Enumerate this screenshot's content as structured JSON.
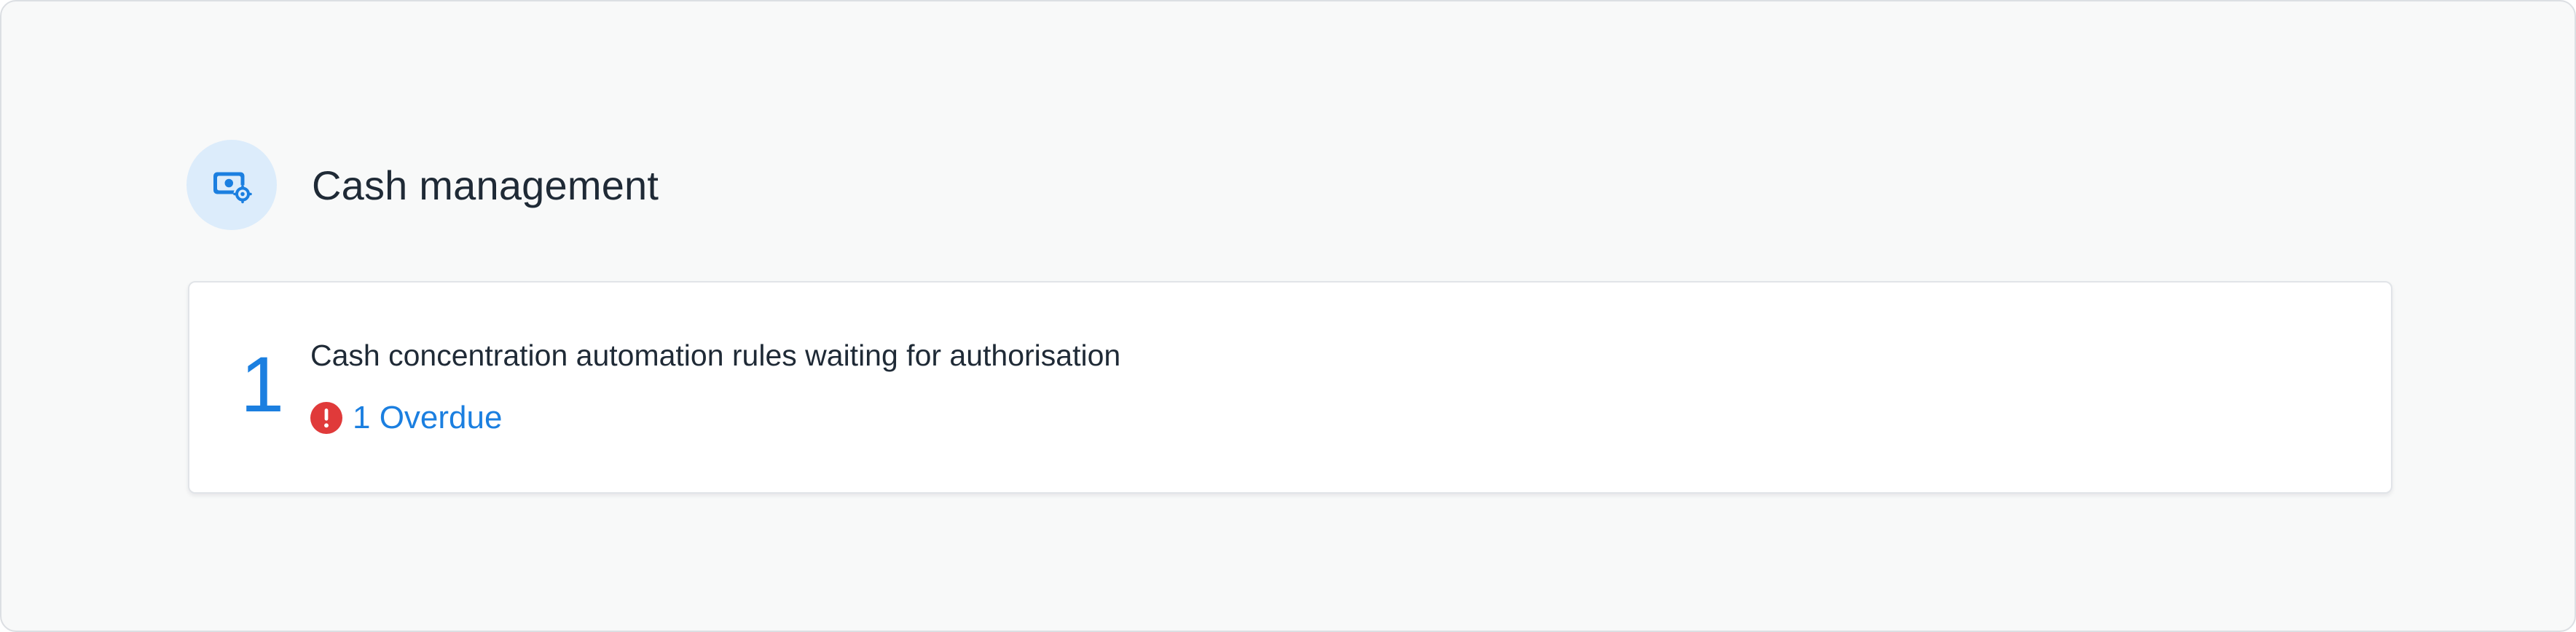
{
  "section": {
    "title": "Cash management",
    "icon": "cash-settings-icon",
    "accent_color": "#1b7fe0",
    "icon_background": "#dcecfb"
  },
  "task": {
    "count": "1",
    "title": "Cash concentration automation rules waiting for authorisation",
    "overdue_label": "1 Overdue",
    "overdue_icon": "alert-circle-icon",
    "overdue_color": "#e03a3a"
  }
}
